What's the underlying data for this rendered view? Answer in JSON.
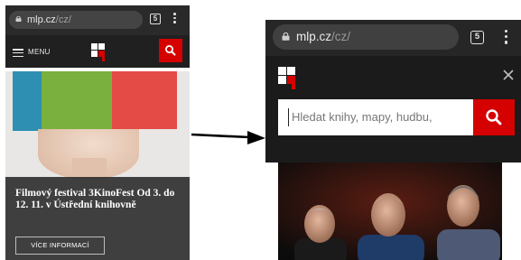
{
  "before": {
    "browser": {
      "url_host": "mlp.cz",
      "url_path": "/cz/",
      "tab_count": "5"
    },
    "header": {
      "menu_label": "MENU"
    },
    "hero": {
      "title": "Filmový festival 3KinoFest Od 3. do 12. 11. v Ústřední knihovně",
      "button_label": "VÍCE INFORMACÍ"
    }
  },
  "after": {
    "browser": {
      "url_host": "mlp.cz",
      "url_path": "/cz/",
      "tab_count": "5"
    },
    "search": {
      "placeholder": "Hledat knihy, mapy, hudbu,"
    }
  },
  "colors": {
    "brand_red": "#d50000",
    "dark_header": "#202020",
    "browser_bar": "#2a2a2a"
  },
  "icons": {
    "lock": "lock-icon",
    "tabs": "tabs-counter-icon",
    "overflow": "more-vertical-icon",
    "menu": "hamburger-icon",
    "search": "search-icon",
    "close": "close-icon",
    "logo": "mlp-logo",
    "arrow": "transition-arrow"
  }
}
